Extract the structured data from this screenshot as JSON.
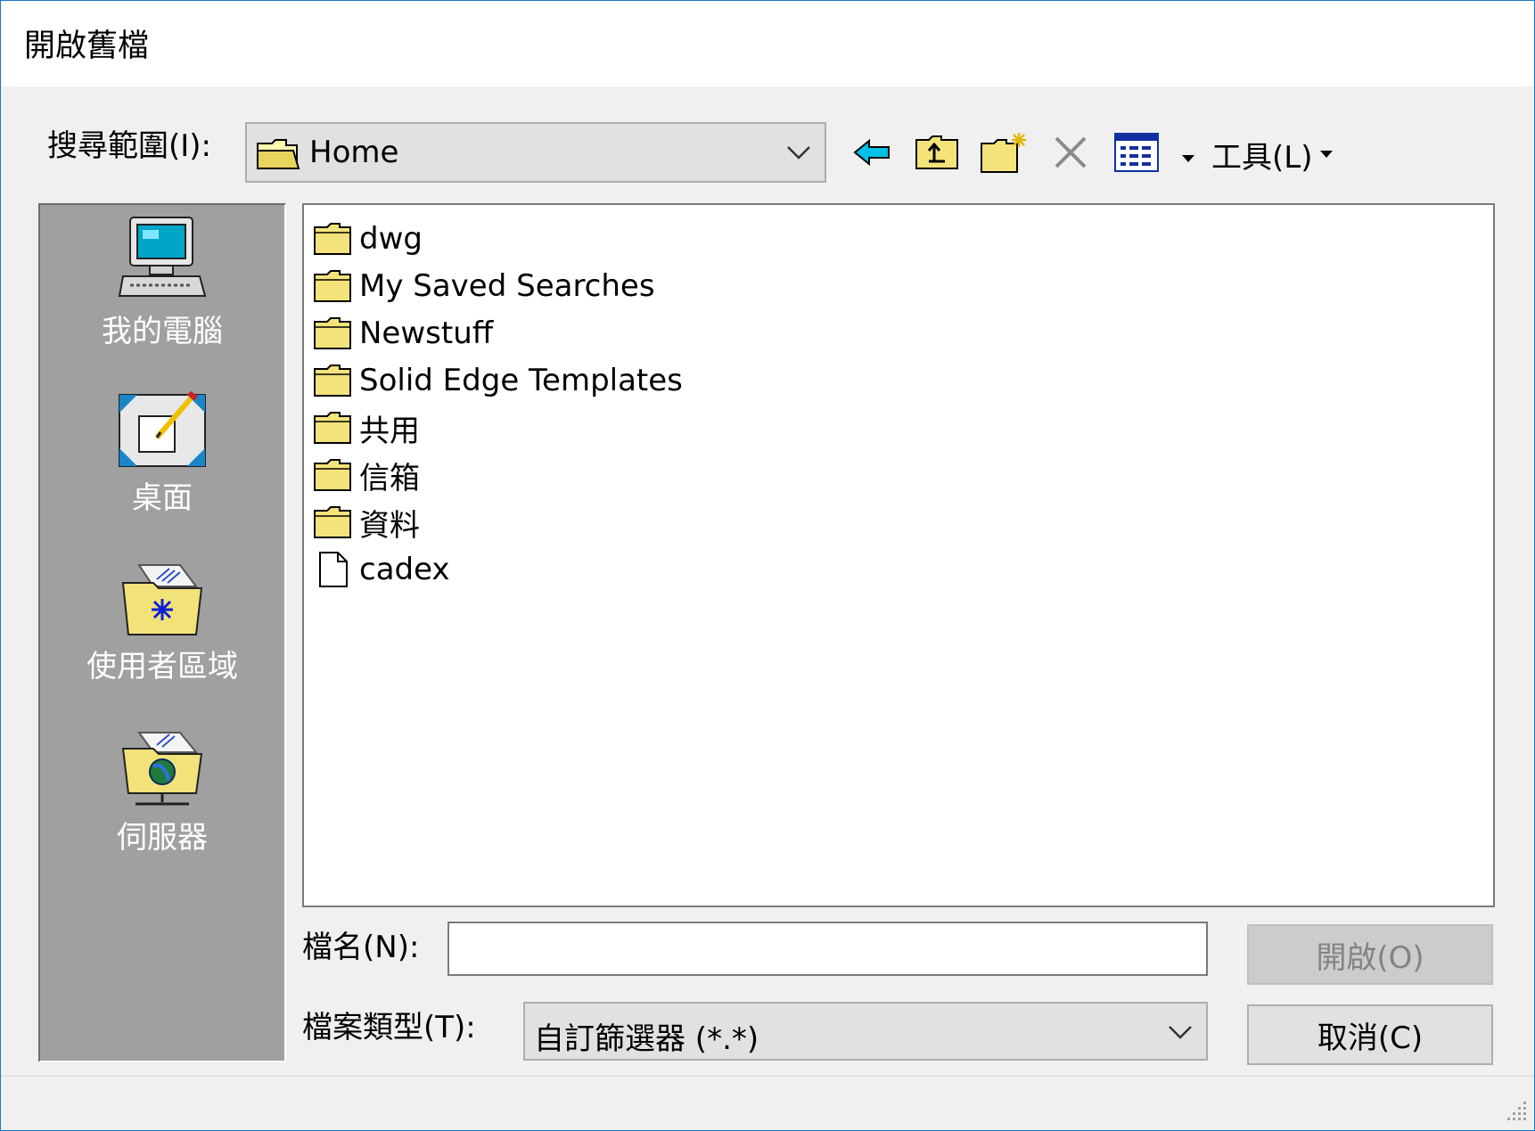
{
  "window": {
    "title": "開啟舊檔"
  },
  "lookin": {
    "label": "搜尋範圍(I):",
    "value": "Home"
  },
  "toolbar": {
    "tools_label": "工具(L)"
  },
  "places": [
    {
      "label": "我的電腦",
      "icon": "my-computer-icon"
    },
    {
      "label": "桌面",
      "icon": "desktop-icon"
    },
    {
      "label": "使用者區域",
      "icon": "user-area-icon"
    },
    {
      "label": "伺服器",
      "icon": "server-icon"
    }
  ],
  "files": [
    {
      "name": "dwg",
      "type": "folder"
    },
    {
      "name": "My Saved Searches",
      "type": "folder"
    },
    {
      "name": "Newstuff",
      "type": "folder"
    },
    {
      "name": "Solid Edge Templates",
      "type": "folder"
    },
    {
      "name": "共用",
      "type": "folder"
    },
    {
      "name": "信箱",
      "type": "folder"
    },
    {
      "name": "資料",
      "type": "folder"
    },
    {
      "name": "cadex",
      "type": "file"
    }
  ],
  "filename": {
    "label": "檔名(N):",
    "value": ""
  },
  "filetype": {
    "label": "檔案類型(T):",
    "value": "自訂篩選器 (*.*)"
  },
  "buttons": {
    "open": "開啟(O)",
    "cancel": "取消(C)"
  }
}
